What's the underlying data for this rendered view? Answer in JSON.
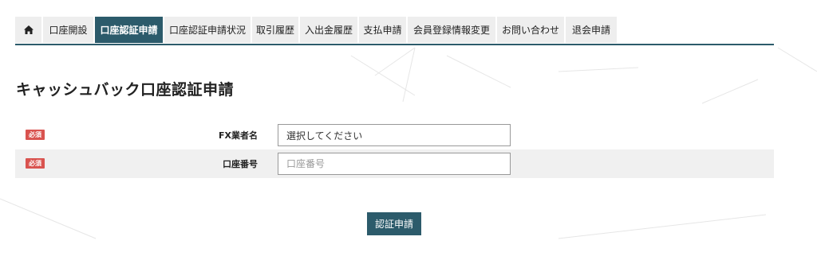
{
  "nav": {
    "home_icon": "home-icon",
    "items": [
      {
        "label": "口座開設"
      },
      {
        "label": "口座認証申請",
        "active": true
      },
      {
        "label": "口座認証申請状況"
      },
      {
        "label": "取引履歴"
      },
      {
        "label": "入出金履歴"
      },
      {
        "label": "支払申請"
      },
      {
        "label": "会員登録情報変更"
      },
      {
        "label": "お問い合わせ"
      },
      {
        "label": "退会申請"
      }
    ]
  },
  "page": {
    "title": "キャッシュバック口座認証申請"
  },
  "form": {
    "required_badge": "必須",
    "fx_company": {
      "label": "FX業者名",
      "value": "選択してください"
    },
    "account_number": {
      "label": "口座番号",
      "placeholder": "口座番号",
      "value": ""
    },
    "submit_label": "認証申請"
  },
  "colors": {
    "accent": "#2c5b6b",
    "required": "#d9534f",
    "tab_bg": "#eeeeee",
    "row_alt": "#f0f0f0"
  }
}
